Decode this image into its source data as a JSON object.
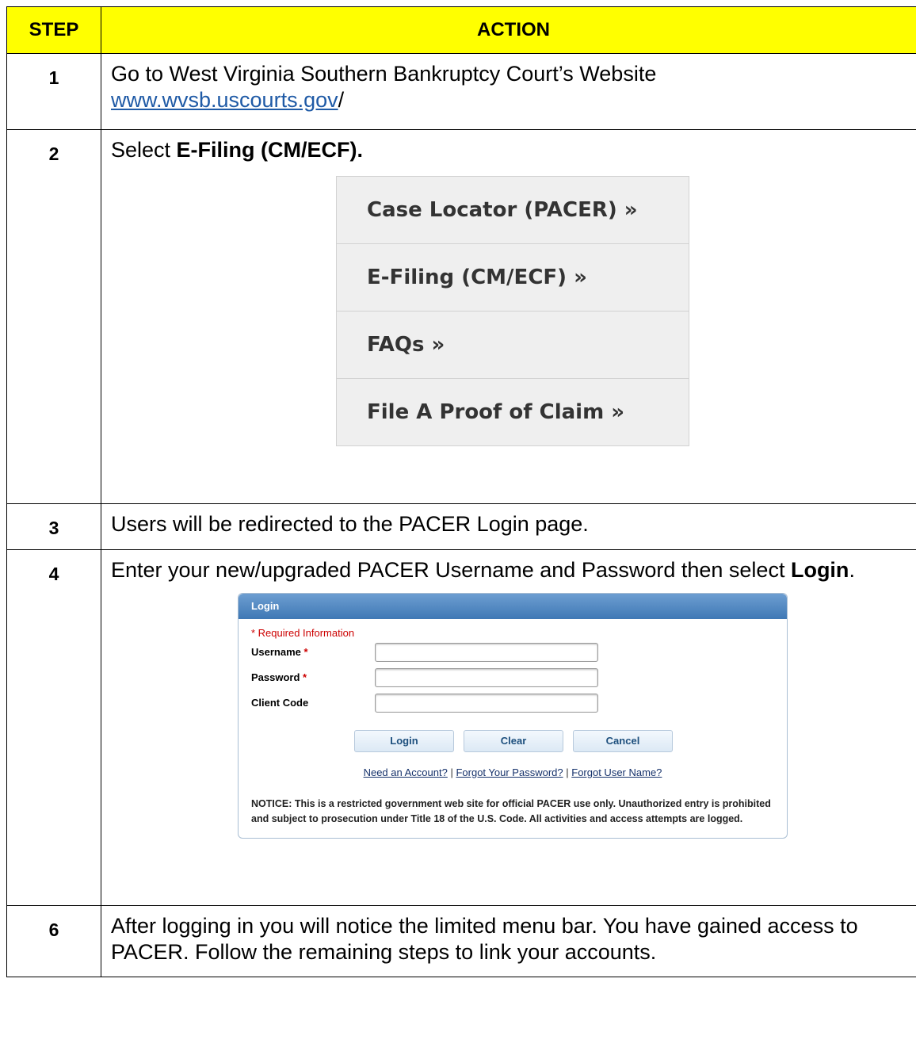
{
  "table": {
    "header_step": "STEP",
    "header_action": "ACTION"
  },
  "steps": [
    {
      "num": "1",
      "text": "Go to West Virginia Southern Bankruptcy Court’s Website",
      "link": "www.wvsb.uscourts.gov",
      "link_suffix": "/"
    },
    {
      "num": "2",
      "text_pre": "Select ",
      "text_bold": "E-Filing (CM/ECF)."
    },
    {
      "num": "3",
      "text": "Users will be redirected to the PACER Login page."
    },
    {
      "num": "4",
      "text_pre": "Enter your new/upgraded PACER Username and Password then select ",
      "text_bold": "Login",
      "text_post": "."
    },
    {
      "num": "6",
      "text": "After logging in you will notice the limited menu bar.  You have gained access to PACER.  Follow the remaining steps to link your accounts."
    }
  ],
  "menu": {
    "items": [
      "Case Locator (PACER) »",
      "E-Filing (CM/ECF) »",
      "FAQs »",
      "File A Proof of Claim »"
    ]
  },
  "login": {
    "title": "Login",
    "required_note": "* Required Information",
    "username_label": "Username",
    "password_label": "Password",
    "client_code_label": "Client Code",
    "asterisk": "*",
    "login_button": "Login",
    "clear_button": "Clear",
    "cancel_button": "Cancel",
    "link_need_account": "Need an Account?",
    "link_forgot_password": "Forgot Your Password?",
    "link_forgot_username": "Forgot User Name?",
    "separator": "|",
    "notice": "NOTICE: This is a restricted government web site for official PACER use only. Unauthorized entry is prohibited and subject to prosecution under Title 18 of the U.S. Code. All activities and access attempts are logged."
  }
}
